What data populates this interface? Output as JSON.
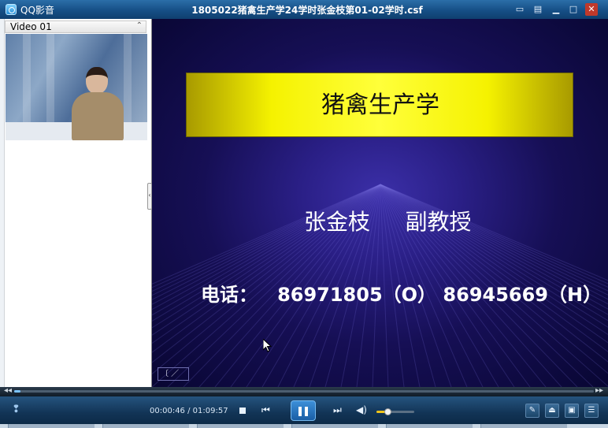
{
  "window": {
    "app_name": "QQ影音",
    "title": "1805022猪禽生产学24学时张金枝第01-02学时.csf",
    "buttons": [
      "chat-icon",
      "minimize-mode-icon",
      "minimize-icon",
      "maximize-icon",
      "close-icon"
    ]
  },
  "playlist": {
    "item_label": "Video 01"
  },
  "slide": {
    "title": "猪禽生产学",
    "author": "张金枝     副教授",
    "phone": "电话：   86971805（O） 86945669（H）",
    "corner_label": "〔 ／"
  },
  "playback": {
    "elapsed": "00:00:46",
    "separator": " / ",
    "total": "01:09:57",
    "progress_fraction": 0.011,
    "volume_fraction": 0.3,
    "state": "playing"
  },
  "colors": {
    "accent": "#2a8fd6",
    "slide_title_band": "#f5f200",
    "video_background": "#1d1870"
  }
}
